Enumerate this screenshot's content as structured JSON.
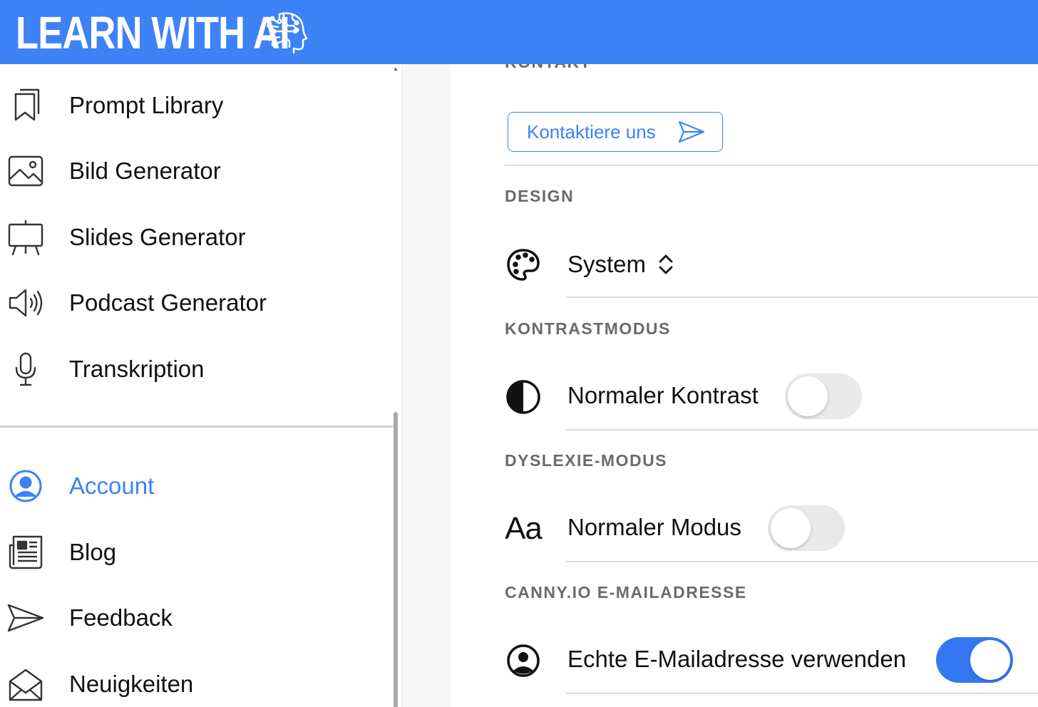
{
  "header": {
    "logo_text": "LEARN WITH AI",
    "brand_color": "#3d82f7",
    "logo_icon": "ai-head-circuit-icon"
  },
  "sidebar": {
    "items": [
      {
        "label": "Prompt Library",
        "icon": "bookmarks-icon"
      },
      {
        "label": "Bild Generator",
        "icon": "image-icon"
      },
      {
        "label": "Slides Generator",
        "icon": "easel-icon"
      },
      {
        "label": "Podcast Generator",
        "icon": "speaker-icon"
      },
      {
        "label": "Transkription",
        "icon": "microphone-icon"
      }
    ],
    "bottom_items": [
      {
        "label": "Account",
        "icon": "user-circle-icon",
        "active": true
      },
      {
        "label": "Blog",
        "icon": "newspaper-icon"
      },
      {
        "label": "Feedback",
        "icon": "send-icon"
      },
      {
        "label": "Neuigkeiten",
        "icon": "envelope-open-icon"
      }
    ],
    "active_color": "#3d82f7"
  },
  "main": {
    "contact": {
      "section_title": "KONTAKT",
      "button_label": "Kontaktiere uns",
      "button_icon": "send-icon"
    },
    "design": {
      "section_title": "DESIGN",
      "value": "System",
      "icon": "palette-icon",
      "select_icon": "chevron-up-down-icon"
    },
    "contrast": {
      "section_title": "KONTRASTMODUS",
      "label": "Normaler Kontrast",
      "icon": "contrast-half-circle-icon",
      "enabled": false
    },
    "dyslexia": {
      "section_title": "DYSLEXIE-MODUS",
      "label": "Normaler Modus",
      "icon_text": "Aa",
      "enabled": false
    },
    "canny": {
      "section_title": "CANNY.IO E-MAILADRESSE",
      "label": "Echte E-Mailadresse verwenden",
      "icon": "user-circle-icon",
      "enabled": true,
      "toggle_on_color": "#3378f2"
    }
  }
}
